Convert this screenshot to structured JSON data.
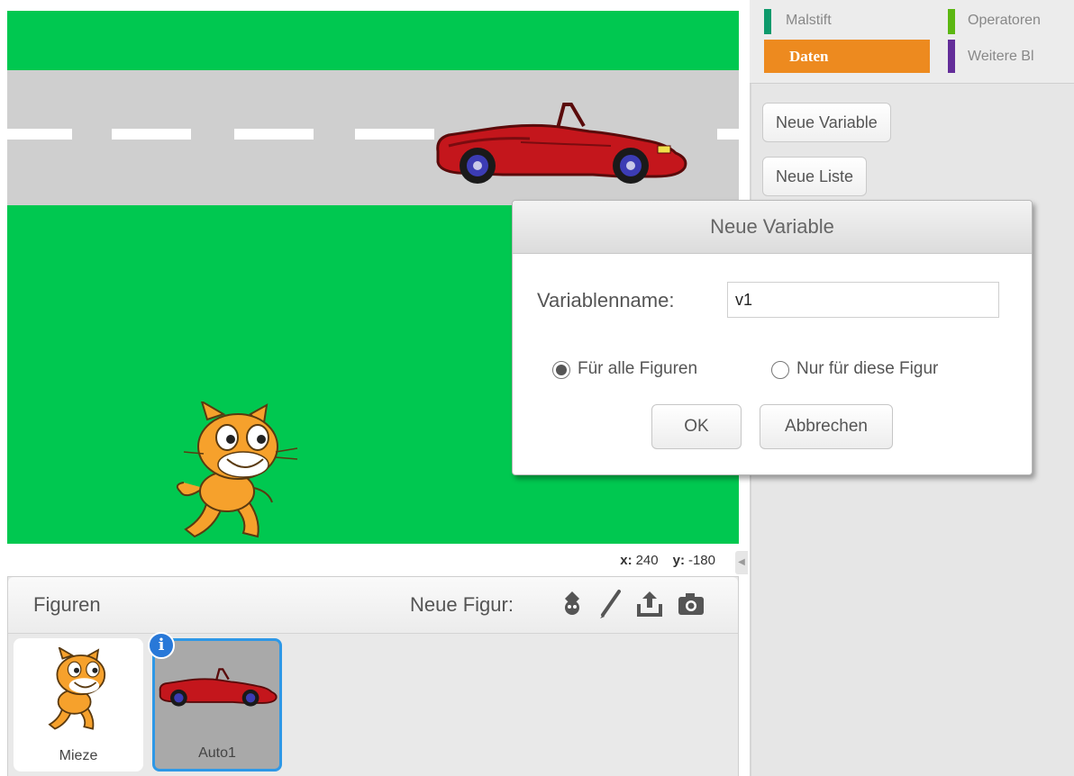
{
  "stage": {
    "coordinates": {
      "x_label": "x:",
      "x_value": "240",
      "y_label": "y:",
      "y_value": "-180"
    }
  },
  "sprites_pane": {
    "title": "Figuren",
    "new_sprite_label": "Neue Figur:",
    "tools": [
      "choose-from-library-icon",
      "paint-icon",
      "upload-icon",
      "camera-icon"
    ],
    "sprites": [
      {
        "name": "Mieze",
        "selected": false
      },
      {
        "name": "Auto1",
        "selected": true
      }
    ],
    "info_badge": "i"
  },
  "palette": {
    "categories": [
      {
        "label": "Malstift",
        "color": "#0e9a6c"
      },
      {
        "label": "Operatoren",
        "color": "#5cb712"
      },
      {
        "label": "Daten",
        "color": "#ee7d16",
        "active": true
      },
      {
        "label": "Weitere Bl",
        "color": "#632d99"
      }
    ],
    "buttons": {
      "new_variable": "Neue Variable",
      "new_list": "Neue Liste"
    }
  },
  "dialog": {
    "title": "Neue Variable",
    "name_label": "Variablenname:",
    "name_value": "v1",
    "options": [
      {
        "label": "Für alle Figuren",
        "checked": true
      },
      {
        "label": "Nur für diese Figur",
        "checked": false
      }
    ],
    "ok_label": "OK",
    "cancel_label": "Abbrechen"
  }
}
